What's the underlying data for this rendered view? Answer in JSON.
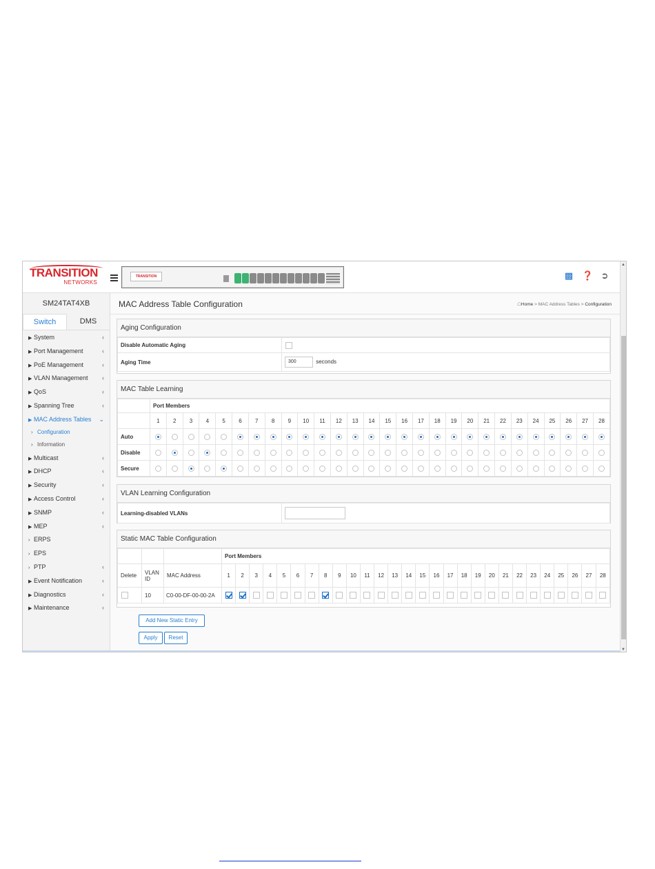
{
  "brand": {
    "line1": "TRANSITION",
    "line2": "NETWORKS",
    "device_logo": "TRANSITION"
  },
  "sidebar": {
    "model": "SM24TAT4XB",
    "tabs": [
      "Switch",
      "DMS"
    ],
    "items": [
      {
        "label": "System",
        "arrow": "right",
        "chevron": "<"
      },
      {
        "label": "Port Management",
        "arrow": "right",
        "chevron": "<"
      },
      {
        "label": "PoE Management",
        "arrow": "right",
        "chevron": "<"
      },
      {
        "label": "VLAN Management",
        "arrow": "right",
        "chevron": "<"
      },
      {
        "label": "QoS",
        "arrow": "right",
        "chevron": "<"
      },
      {
        "label": "Spanning Tree",
        "arrow": "right",
        "chevron": "<"
      },
      {
        "label": "MAC Address Tables",
        "arrow": "right",
        "chevron": "v",
        "active": true
      },
      {
        "label": "Configuration",
        "sub": true,
        "active": true
      },
      {
        "label": "Information",
        "sub": true
      },
      {
        "label": "Multicast",
        "arrow": "right",
        "chevron": "<"
      },
      {
        "label": "DHCP",
        "arrow": "right",
        "chevron": "<"
      },
      {
        "label": "Security",
        "arrow": "right",
        "chevron": "<"
      },
      {
        "label": "Access Control",
        "arrow": "right",
        "chevron": "<"
      },
      {
        "label": "SNMP",
        "arrow": "right",
        "chevron": "<"
      },
      {
        "label": "MEP",
        "arrow": "right",
        "chevron": "<"
      },
      {
        "label": "ERPS",
        "arrow": "gt",
        "chevron": ""
      },
      {
        "label": "EPS",
        "arrow": "gt",
        "chevron": ""
      },
      {
        "label": "PTP",
        "arrow": "gt",
        "chevron": "<"
      },
      {
        "label": "Event Notification",
        "arrow": "right",
        "chevron": "<"
      },
      {
        "label": "Diagnostics",
        "arrow": "right",
        "chevron": "<"
      },
      {
        "label": "Maintenance",
        "arrow": "right",
        "chevron": "<"
      }
    ]
  },
  "page": {
    "title": "MAC Address Table Configuration",
    "breadcrumb": {
      "home": "Home",
      "sep": ">",
      "section": "MAC Address Tables",
      "current": "Configuration"
    }
  },
  "aging": {
    "heading": "Aging Configuration",
    "disable_label": "Disable Automatic Aging",
    "disable_checked": false,
    "time_label": "Aging Time",
    "time_value": "300",
    "time_unit": "seconds"
  },
  "learning": {
    "heading": "MAC Table Learning",
    "port_members_label": "Port Members",
    "ports": [
      "1",
      "2",
      "3",
      "4",
      "5",
      "6",
      "7",
      "8",
      "9",
      "10",
      "11",
      "12",
      "13",
      "14",
      "15",
      "16",
      "17",
      "18",
      "19",
      "20",
      "21",
      "22",
      "23",
      "24",
      "25",
      "26",
      "27",
      "28"
    ],
    "rows": [
      {
        "label": "Auto",
        "key": "auto"
      },
      {
        "label": "Disable",
        "key": "disable"
      },
      {
        "label": "Secure",
        "key": "secure"
      }
    ],
    "selection": [
      "auto",
      "disable",
      "secure",
      "disable",
      "secure",
      "auto",
      "auto",
      "auto",
      "auto",
      "auto",
      "auto",
      "auto",
      "auto",
      "auto",
      "auto",
      "auto",
      "auto",
      "auto",
      "auto",
      "auto",
      "auto",
      "auto",
      "auto",
      "auto",
      "auto",
      "auto",
      "auto",
      "auto"
    ]
  },
  "vlan_learning": {
    "heading": "VLAN Learning Configuration",
    "label": "Learning-disabled VLANs",
    "value": ""
  },
  "static_mac": {
    "heading": "Static MAC Table Configuration",
    "port_members_label": "Port Members",
    "col_delete": "Delete",
    "col_vlan": "VLAN ID",
    "col_mac": "MAC Address",
    "entries": [
      {
        "delete": false,
        "vlan": "10",
        "mac": "C0-00-DF-00-00-2A",
        "members": [
          1,
          2,
          8
        ]
      }
    ]
  },
  "buttons": {
    "add": "Add New Static Entry",
    "apply": "Apply",
    "reset": "Reset"
  },
  "colors": {
    "accent": "#2a7fd1",
    "brand": "#d7262b",
    "port_active": "#3cb371"
  }
}
